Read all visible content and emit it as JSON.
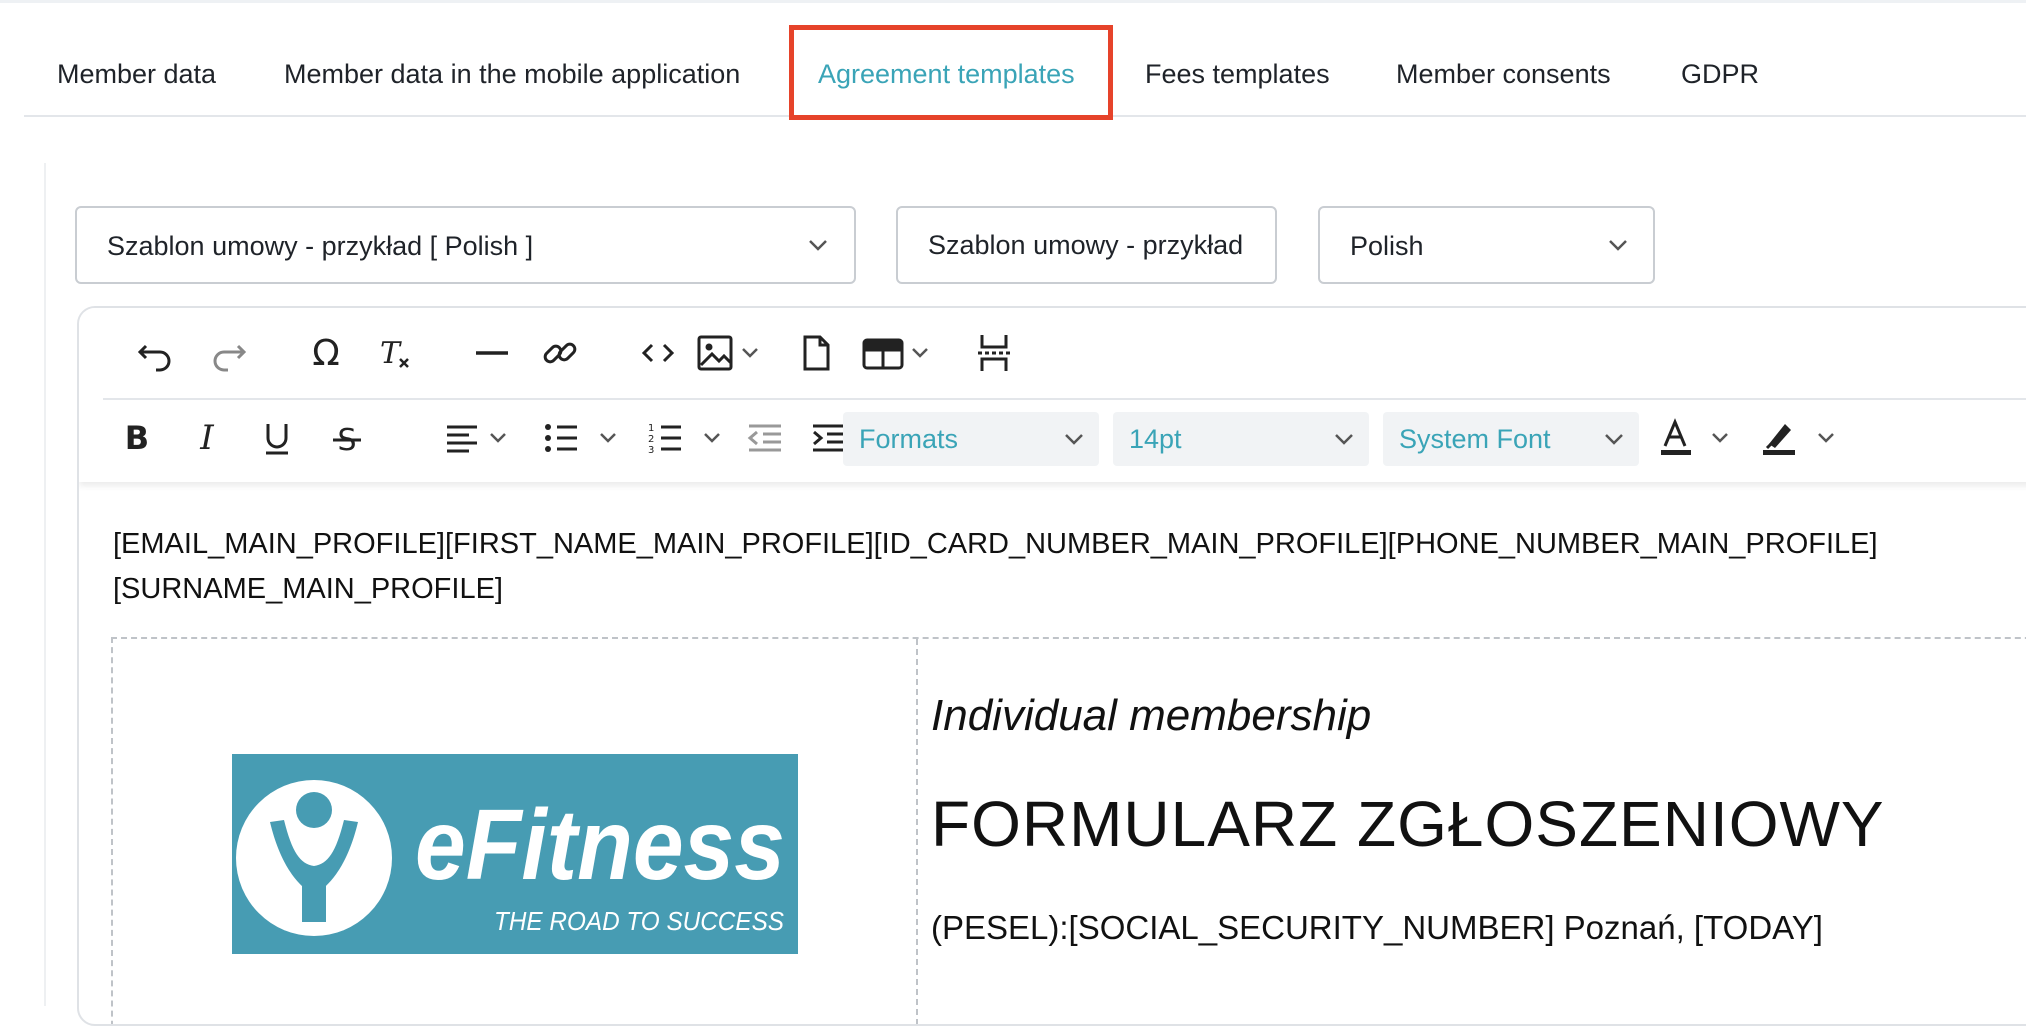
{
  "tabs": [
    {
      "label": "Member data"
    },
    {
      "label": "Member data in the mobile application"
    },
    {
      "label": "Agreement templates"
    },
    {
      "label": "Fees templates"
    },
    {
      "label": "Member consents"
    },
    {
      "label": "GDPR"
    }
  ],
  "active_tab": "Agreement templates",
  "highlight_color": "#e6432a",
  "accent_color": "#3aa4b7",
  "template_select": {
    "value": "Szablon umowy - przykład [ Polish ]"
  },
  "template_name_input": {
    "value": "Szablon umowy - przykład"
  },
  "language_select": {
    "value": "Polish"
  },
  "toolbar": {
    "row1_icons": [
      "undo-icon",
      "redo-icon",
      "special-character-icon",
      "clear-formatting-icon",
      "horizontal-line-icon",
      "link-icon",
      "source-code-icon",
      "image-icon",
      "new-document-icon",
      "table-icon",
      "page-break-icon"
    ],
    "row2_icons": [
      "bold-icon",
      "italic-icon",
      "underline-icon",
      "strikethrough-icon",
      "align-left-icon",
      "bullet-list-icon",
      "numbered-list-icon",
      "outdent-icon",
      "indent-icon",
      "text-color-icon",
      "highlight-color-icon"
    ],
    "formats_label": "Formats",
    "font_size_label": "14pt",
    "font_family_label": "System Font"
  },
  "document": {
    "placeholders_line1": "[EMAIL_MAIN_PROFILE][FIRST_NAME_MAIN_PROFILE][ID_CARD_NUMBER_MAIN_PROFILE][PHONE_NUMBER_MAIN_PROFILE]",
    "placeholders_line2": "[SURNAME_MAIN_PROFILE]",
    "subtitle": "Individual membership",
    "title": "FORMULARZ ZGŁOSZENIOWY",
    "line": "(PESEL):[SOCIAL_SECURITY_NUMBER] Poznań, [TODAY]",
    "logo": {
      "brand": "eFitness",
      "tagline": "THE ROAD TO SUCCESS",
      "color": "#479cb3"
    }
  }
}
